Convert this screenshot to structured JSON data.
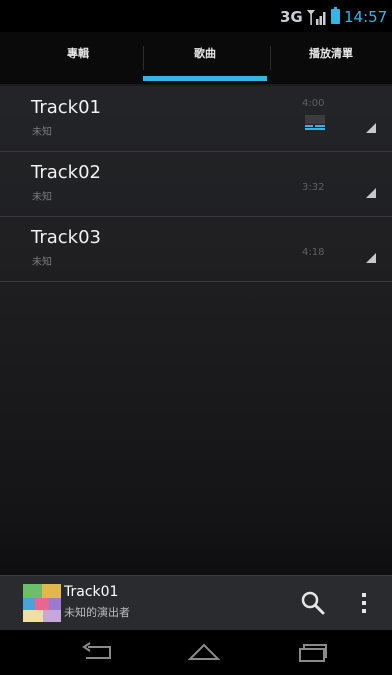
{
  "status_bar": {
    "network": "3G",
    "time": "14:57",
    "accent_color": "#33b5e5"
  },
  "tabs": [
    {
      "label": "專輯",
      "selected": false
    },
    {
      "label": "歌曲",
      "selected": true
    },
    {
      "label": "播放清單",
      "selected": false
    }
  ],
  "tracks": [
    {
      "title": "Track01",
      "artist": "未知",
      "duration": "4:00",
      "playing": true
    },
    {
      "title": "Track02",
      "artist": "未知",
      "duration": "3:32",
      "playing": false
    },
    {
      "title": "Track03",
      "artist": "未知",
      "duration": "4:18",
      "playing": false
    }
  ],
  "now_playing": {
    "title": "Track01",
    "artist": "未知的演出者",
    "search_icon": "search-icon",
    "menu_icon": "overflow-menu-icon"
  },
  "navigation": {
    "back_icon": "back-icon",
    "home_icon": "home-icon",
    "recents_icon": "recent-apps-icon"
  }
}
